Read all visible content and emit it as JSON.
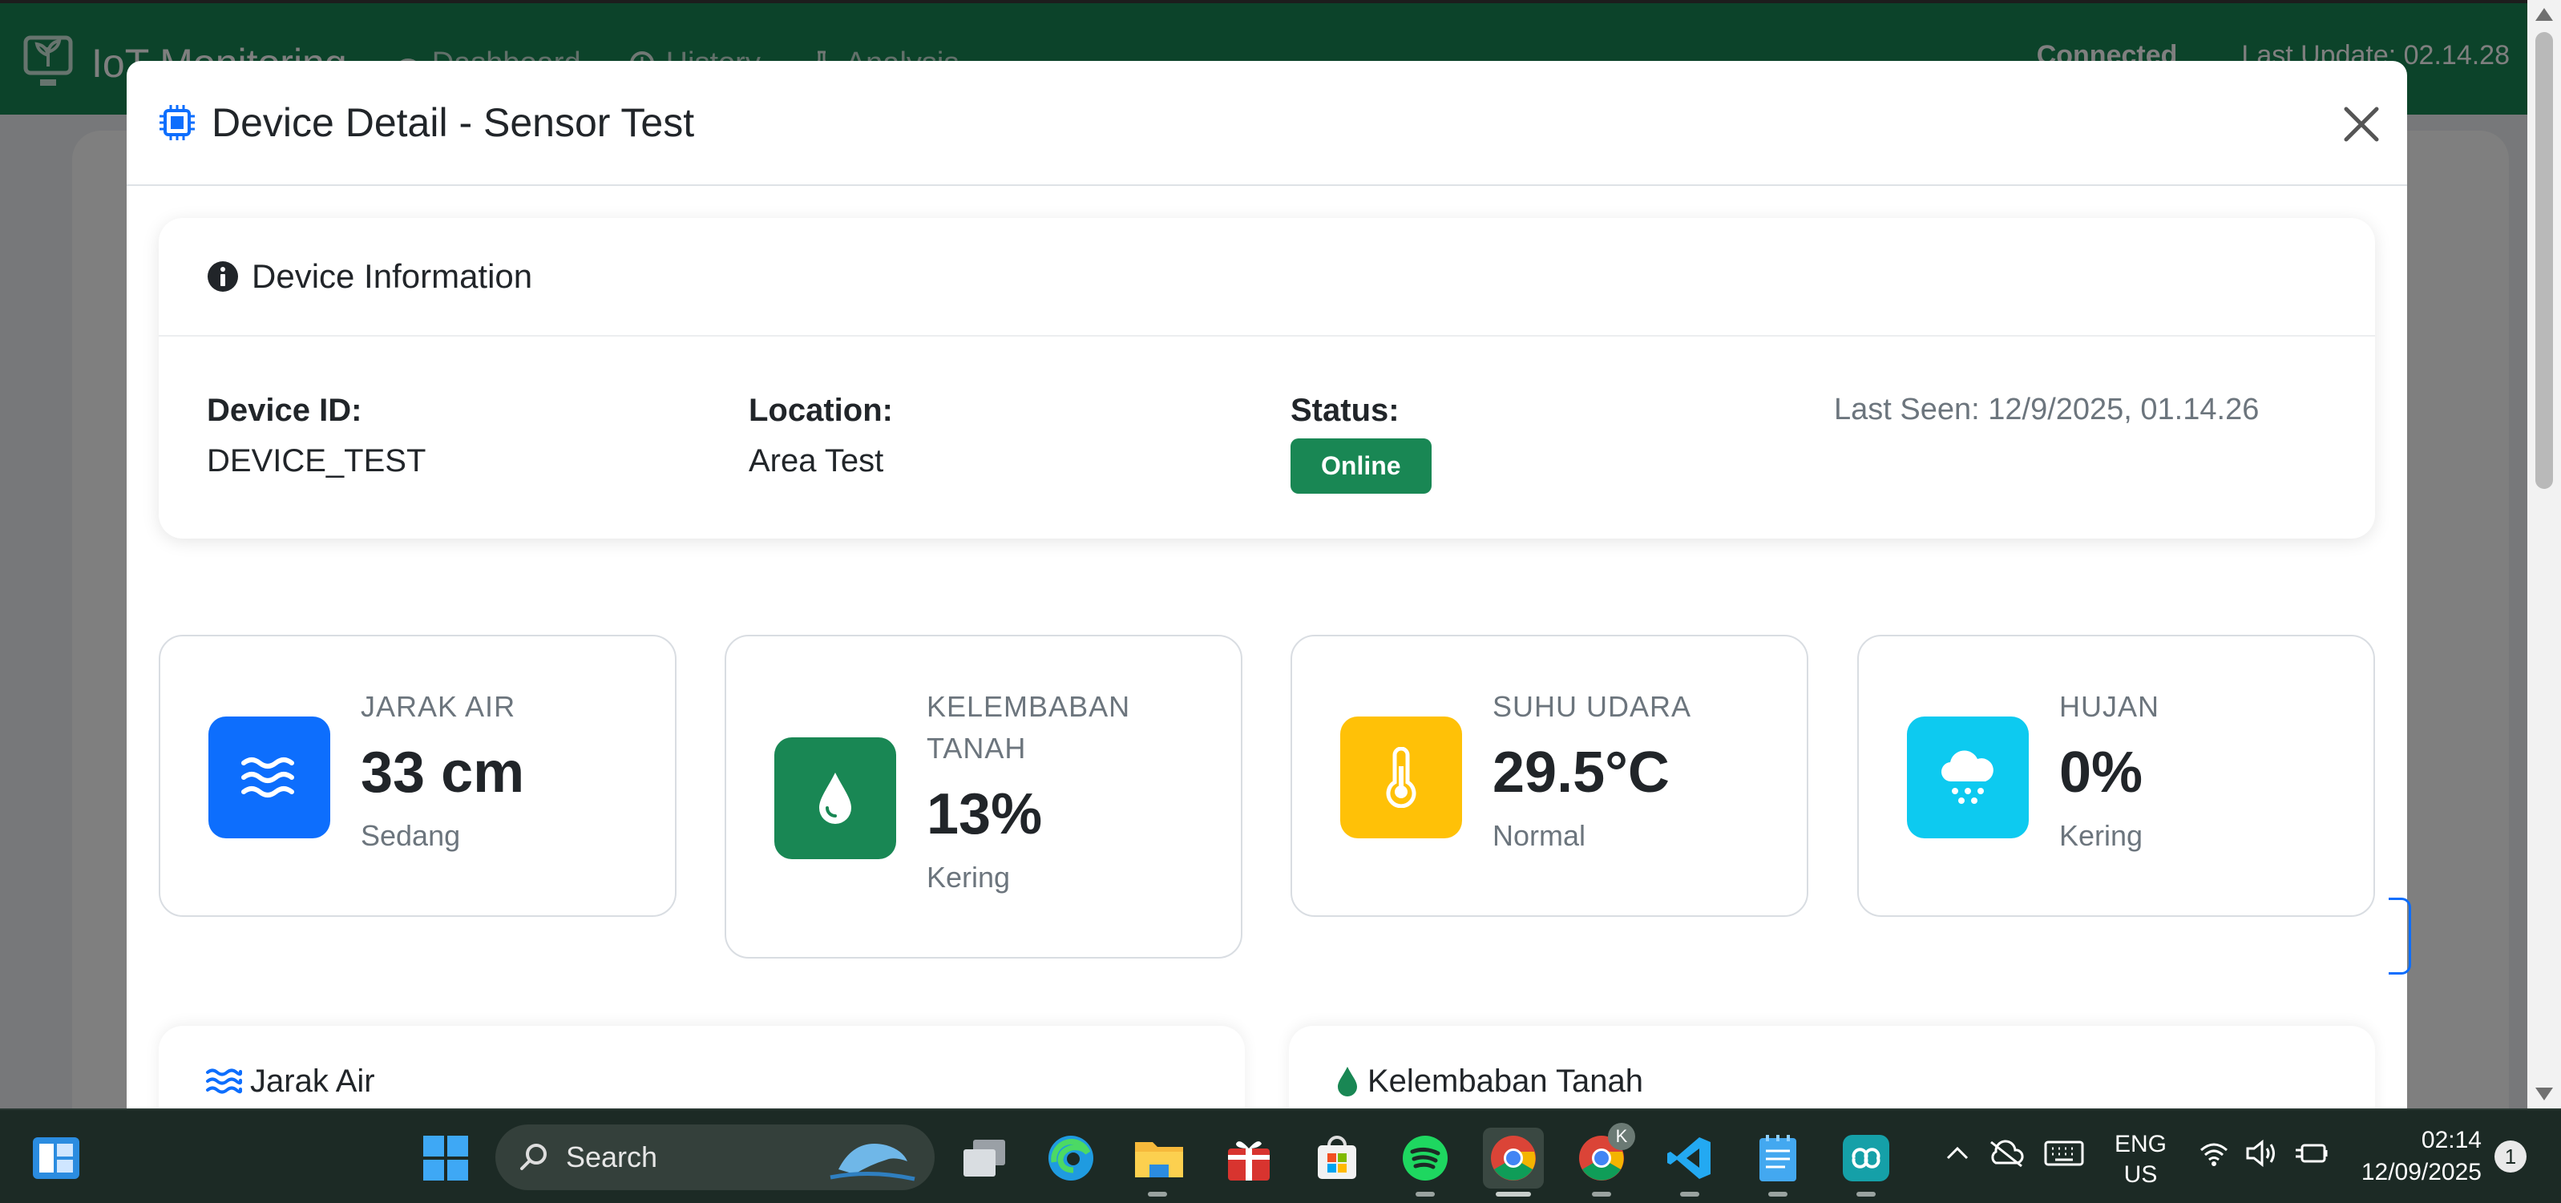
{
  "background_app": {
    "brand": "IoT Monitoring",
    "nav": [
      "Dashboard",
      "History",
      "Analysis"
    ],
    "connection": "Connected",
    "last_update": "Last Update: 02.14.28"
  },
  "modal": {
    "title": "Device Detail - Sensor Test",
    "info": {
      "title": "Device Information",
      "device_id_label": "Device ID:",
      "device_id": "DEVICE_TEST",
      "location_label": "Location:",
      "location": "Area Test",
      "status_label": "Status:",
      "status": "Online",
      "last_seen": "Last Seen: 12/9/2025, 01.14.26"
    },
    "metrics": [
      {
        "label": "JARAK AIR",
        "value": "33 cm",
        "status": "Sedang",
        "icon": "water-waves-icon",
        "color": "#0d6efd"
      },
      {
        "label": "KELEMBABAN TANAH",
        "value": "13%",
        "status": "Kering",
        "icon": "droplet-icon",
        "color": "#198754"
      },
      {
        "label": "SUHU UDARA",
        "value": "29.5°C",
        "status": "Normal",
        "icon": "thermometer-icon",
        "color": "#ffc107"
      },
      {
        "label": "HUJAN",
        "value": "0%",
        "status": "Kering",
        "icon": "cloud-rain-icon",
        "color": "#0dcaf0"
      }
    ],
    "charts": [
      {
        "title": "Jarak Air",
        "icon": "water-waves-icon",
        "color": "#0d6efd"
      },
      {
        "title": "Kelembaban Tanah",
        "icon": "droplet-icon",
        "color": "#198754"
      }
    ]
  },
  "taskbar": {
    "search_placeholder": "Search",
    "lang_top": "ENG",
    "lang_bottom": "US",
    "time": "02:14",
    "date": "12/09/2025",
    "notification_count": "1",
    "badge_letter": "K"
  }
}
